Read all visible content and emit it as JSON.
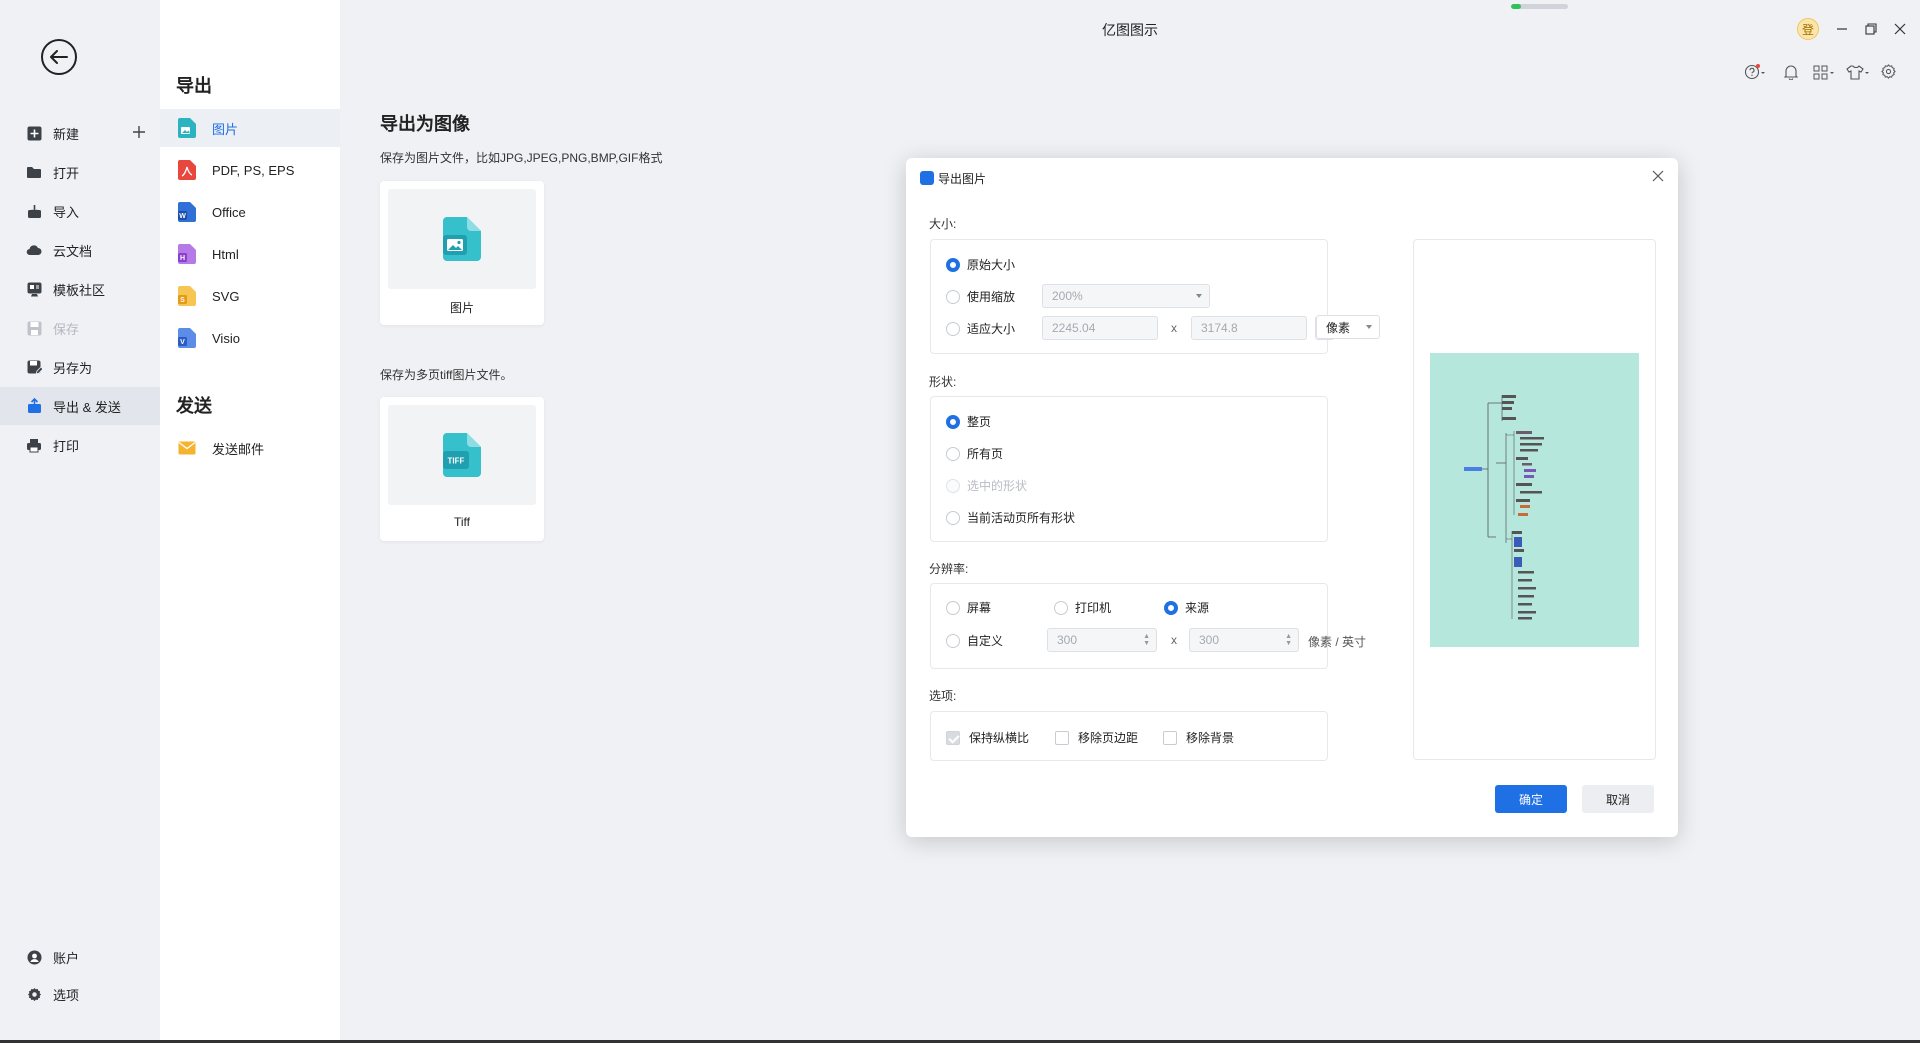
{
  "app_title": "亿图图示",
  "colors": {
    "accent": "#1f6fe5",
    "preview_bg": "#b6e7dd",
    "progress": "#2fc25b"
  },
  "progress": {
    "fraction": 0.18
  },
  "window": {
    "login_badge": "登"
  },
  "left_nav": {
    "items": [
      {
        "label": "新建",
        "icon": "plus-square-icon"
      },
      {
        "label": "打开",
        "icon": "folder-icon"
      },
      {
        "label": "导入",
        "icon": "import-icon"
      },
      {
        "label": "云文档",
        "icon": "cloud-icon"
      },
      {
        "label": "模板社区",
        "icon": "template-icon"
      },
      {
        "label": "保存",
        "icon": "save-icon"
      },
      {
        "label": "另存为",
        "icon": "save-as-icon"
      },
      {
        "label": "导出 & 发送",
        "icon": "export-icon"
      },
      {
        "label": "打印",
        "icon": "print-icon"
      }
    ],
    "bottom": [
      {
        "label": "账户",
        "icon": "account-icon"
      },
      {
        "label": "选项",
        "icon": "gear-icon"
      }
    ]
  },
  "sub_nav": {
    "export_heading": "导出",
    "export_items": [
      {
        "label": "图片",
        "color": "#2bb3c0"
      },
      {
        "label": "PDF, PS, EPS",
        "color": "#e8473e"
      },
      {
        "label": "Office",
        "color": "#2f6fd6"
      },
      {
        "label": "Html",
        "color": "#9b4fd8"
      },
      {
        "label": "SVG",
        "color": "#f5b32e"
      },
      {
        "label": "Visio",
        "color": "#3a6fd8"
      }
    ],
    "send_heading": "发送",
    "send_items": [
      {
        "label": "发送邮件",
        "color": "#f5b32e"
      }
    ]
  },
  "main": {
    "title": "导出为图像",
    "desc": "保存为图片文件，比如JPG,JPEG,PNG,BMP,GIF格式",
    "card_image_label": "图片",
    "desc2": "保存为多页tiff图片文件。",
    "card_tiff_label": "Tiff",
    "tiff_badge": "TIFF"
  },
  "dialog": {
    "title": "导出图片",
    "size": {
      "label": "大小:",
      "original": "原始大小",
      "use_zoom": "使用缩放",
      "zoom_value": "200%",
      "fit": "适应大小",
      "width": "2245.04",
      "times": "x",
      "height": "3174.8",
      "unit": "像素"
    },
    "shape": {
      "label": "形状:",
      "whole_page": "整页",
      "all_pages": "所有页",
      "selected": "选中的形状",
      "current_active": "当前活动页所有形状"
    },
    "resolution": {
      "label": "分辨率:",
      "screen": "屏幕",
      "printer": "打印机",
      "source": "来源",
      "custom": "自定义",
      "dpi_x": "300",
      "times": "x",
      "dpi_y": "300",
      "unit": "像素 / 英寸"
    },
    "options": {
      "label": "选项:",
      "keep_ratio": "保持纵横比",
      "remove_margin": "移除页边距",
      "remove_bg": "移除背景"
    },
    "ok": "确定",
    "cancel": "取消"
  }
}
